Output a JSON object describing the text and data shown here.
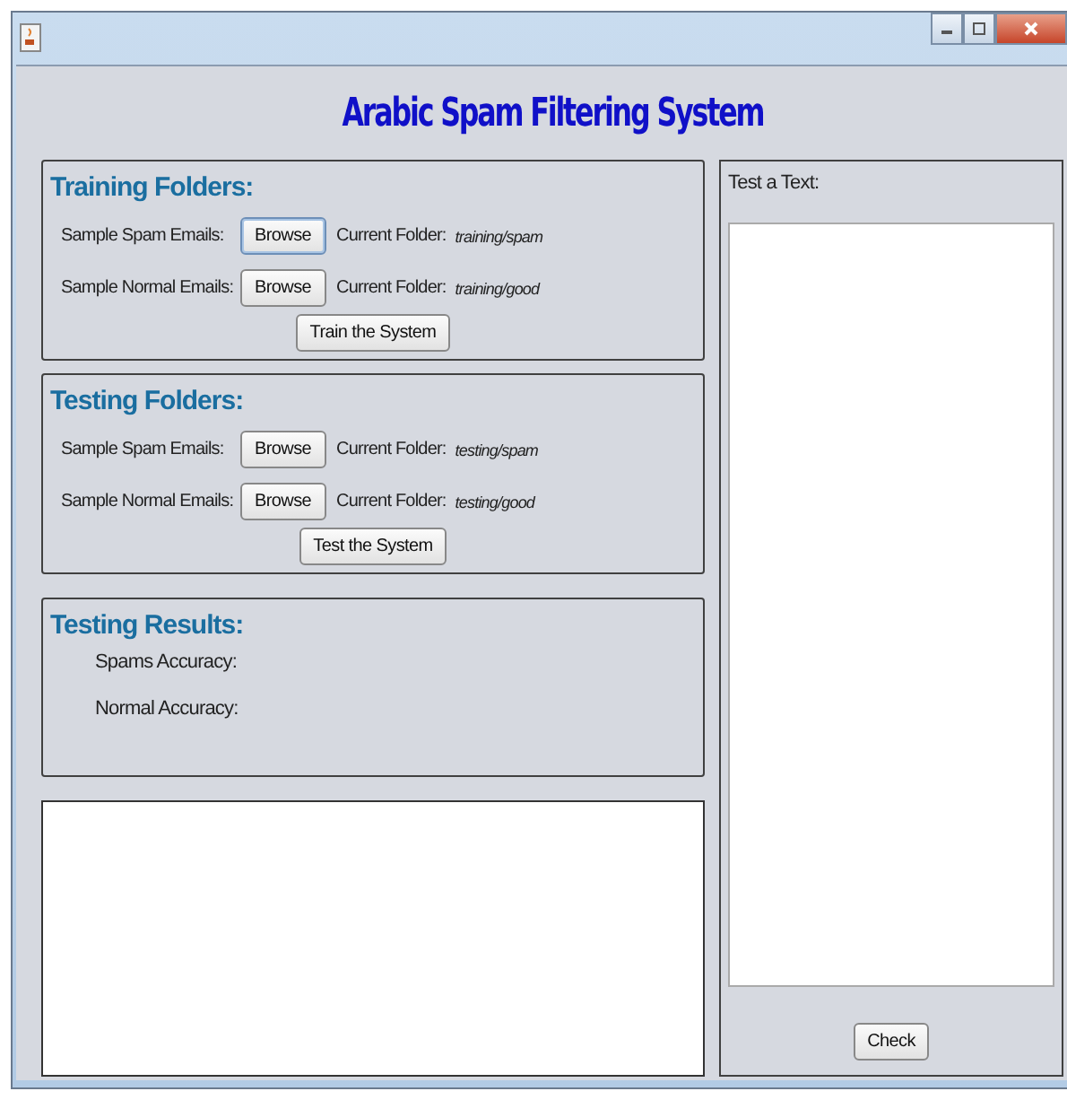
{
  "heading": "Arabic Spam Filtering System",
  "training": {
    "title": "Training Folders:",
    "rows": [
      {
        "label": "Sample Spam Emails:",
        "button": "Browse",
        "focused": true,
        "folder_label": "Current Folder:",
        "folder": "training/spam"
      },
      {
        "label": "Sample Normal Emails:",
        "button": "Browse",
        "focused": false,
        "folder_label": "Current Folder:",
        "folder": "training/good"
      }
    ],
    "action": "Train the System"
  },
  "testing": {
    "title": "Testing Folders:",
    "rows": [
      {
        "label": "Sample Spam Emails:",
        "button": "Browse",
        "focused": false,
        "folder_label": "Current Folder:",
        "folder": "testing/spam"
      },
      {
        "label": "Sample Normal Emails:",
        "button": "Browse",
        "focused": false,
        "folder_label": "Current Folder:",
        "folder": "testing/good"
      }
    ],
    "action": "Test the System"
  },
  "results": {
    "title": "Testing Results:",
    "items": [
      "Spams Accuracy:",
      "Normal Accuracy:"
    ]
  },
  "test_panel": {
    "label": "Test a Text:",
    "button": "Check"
  }
}
